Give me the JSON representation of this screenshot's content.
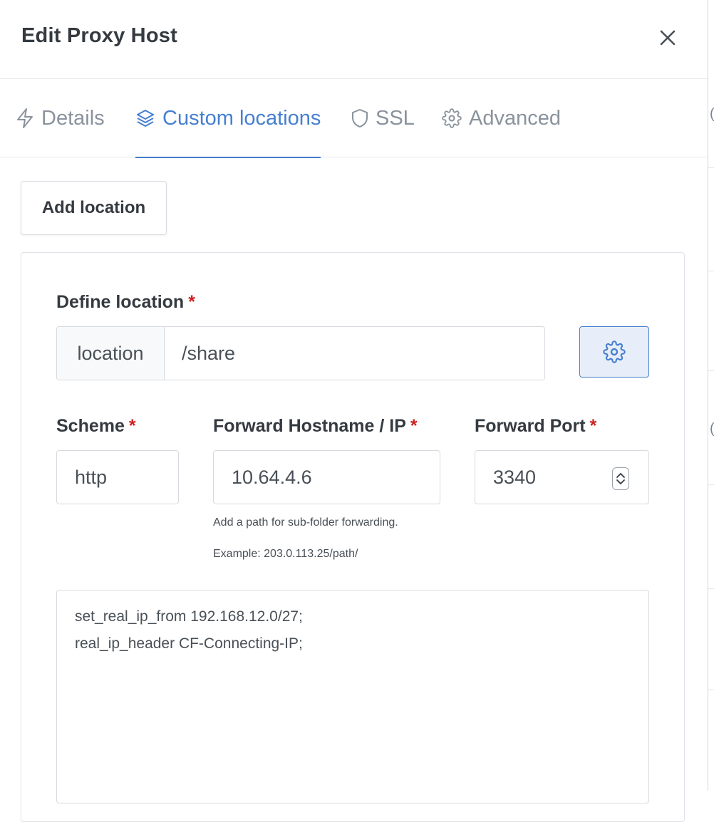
{
  "modal": {
    "title": "Edit Proxy Host",
    "close_icon": "close-icon"
  },
  "tabs": [
    {
      "label": "Details",
      "icon": "lightning-icon",
      "active": false
    },
    {
      "label": "Custom locations",
      "icon": "layers-icon",
      "active": true
    },
    {
      "label": "SSL",
      "icon": "shield-icon",
      "active": false
    },
    {
      "label": "Advanced",
      "icon": "gear-icon",
      "active": false
    }
  ],
  "add_location_label": "Add location",
  "location": {
    "label": "Define location",
    "required_mark": "*",
    "addon": "location",
    "value": "/share",
    "settings_icon": "gear-icon"
  },
  "scheme": {
    "label": "Scheme",
    "required_mark": "*",
    "value": "http"
  },
  "forward_host": {
    "label": "Forward Hostname / IP",
    "required_mark": "*",
    "value": "10.64.4.6",
    "hint": "Add a path for sub-folder forwarding.",
    "example": "Example: 203.0.113.25/path/"
  },
  "forward_port": {
    "label": "Forward Port",
    "required_mark": "*",
    "value": "3340"
  },
  "custom_config": "set_real_ip_from 192.168.12.0/27;\nreal_ip_header CF-Connecting-IP;",
  "colors": {
    "accent": "#467fcf",
    "required": "#cd201f",
    "muted_tab": "#8a939d"
  }
}
